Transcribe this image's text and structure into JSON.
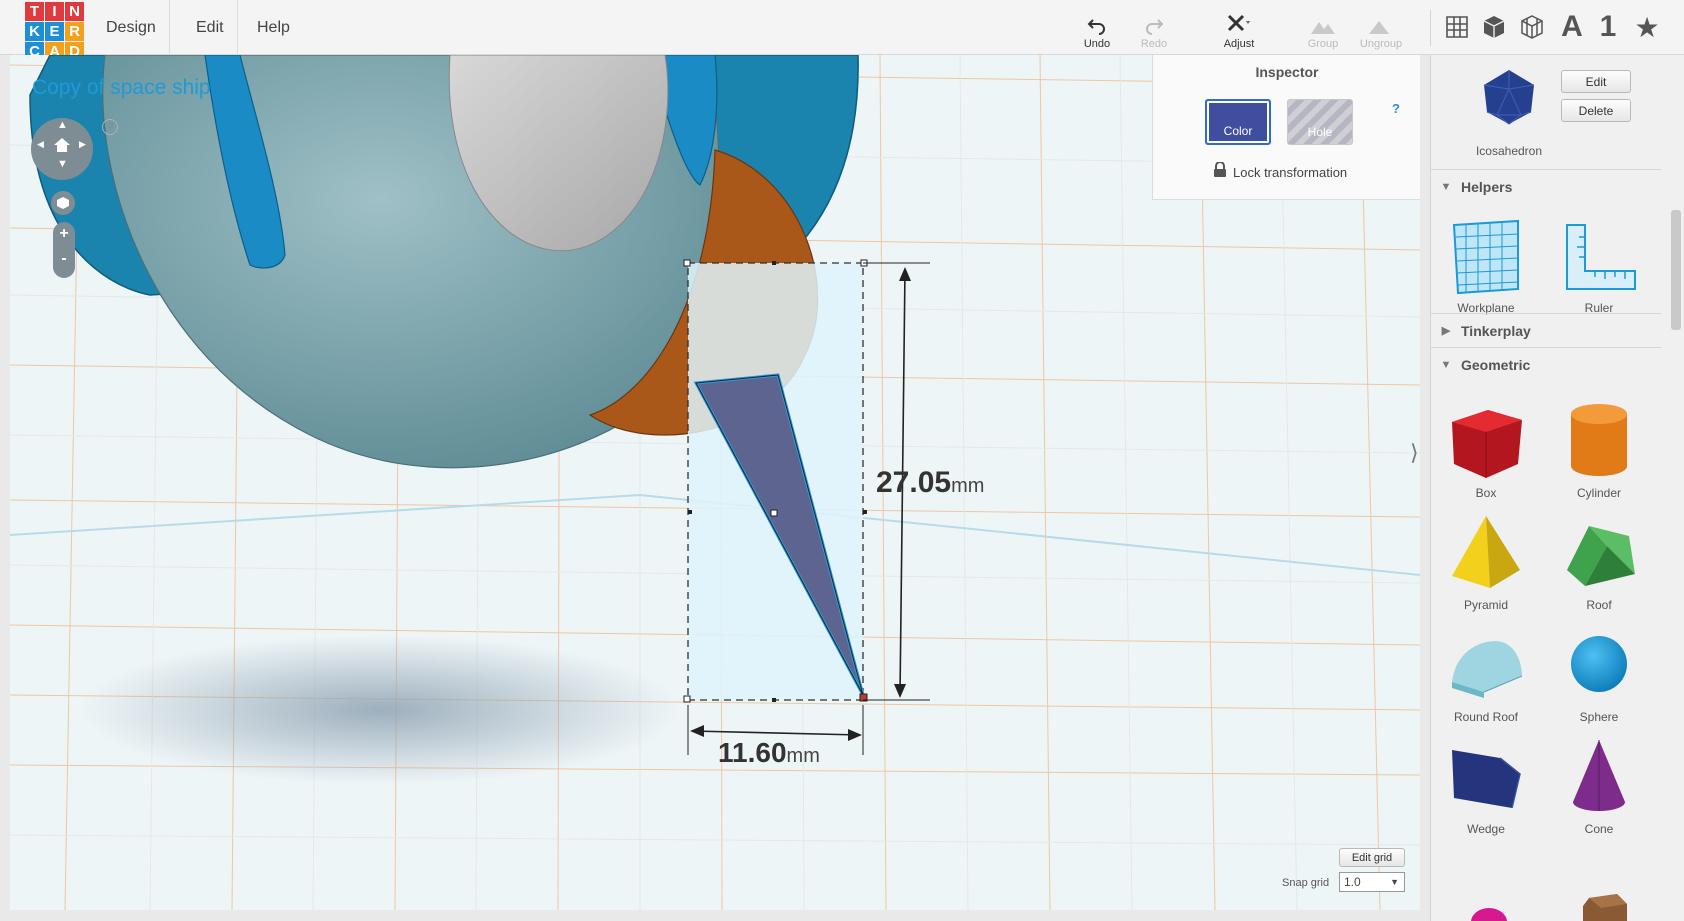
{
  "app": {
    "logo_letters": [
      "T",
      "I",
      "N",
      "K",
      "E",
      "R",
      "C",
      "A",
      "D"
    ],
    "logo_colors": [
      "#e03a3e",
      "#e03a3e",
      "#e03a3e",
      "#1e8fd6",
      "#1e8fd6",
      "#f3a01b",
      "#1e8fd6",
      "#f3a01b",
      "#f3a01b"
    ]
  },
  "menu": {
    "design": "Design",
    "edit": "Edit",
    "help": "Help"
  },
  "toolbar": {
    "undo": "Undo",
    "redo": "Redo",
    "adjust": "Adjust",
    "group": "Group",
    "ungroup": "Ungroup"
  },
  "view_icons": {
    "grid": "grid-view-icon",
    "box": "box-view-icon",
    "wire": "wireframe-view-icon",
    "letter": "A",
    "number": "1",
    "star": "star-icon"
  },
  "canvas": {
    "design_title": "Copy of space ship",
    "help": "?",
    "nav_zoom_in": "+",
    "nav_zoom_out": "-",
    "height_value": "27.05",
    "width_value": "11.60",
    "unit": "mm",
    "edit_grid": "Edit grid",
    "snap_grid_label": "Snap grid",
    "snap_grid_value": "1.0"
  },
  "inspector": {
    "title": "Inspector",
    "color_label": "Color",
    "hole_label": "Hole",
    "help": "?",
    "lock_label": "Lock transformation"
  },
  "sidebar": {
    "selected_shape": "Icosahedron",
    "edit": "Edit",
    "delete": "Delete",
    "helpers_title": "Helpers",
    "helpers": [
      "Workplane",
      "Ruler"
    ],
    "tinkerplay_title": "Tinkerplay",
    "geometric_title": "Geometric",
    "shapes": [
      "Box",
      "Cylinder",
      "Pyramid",
      "Roof",
      "Round Roof",
      "Sphere",
      "Wedge",
      "Cone"
    ]
  },
  "colors": {
    "accent": "#3f4e9e",
    "selection_fill": "#dff3fb",
    "orange": "#a9581a",
    "teal": "#7fa9b0",
    "blue": "#1186c8"
  }
}
